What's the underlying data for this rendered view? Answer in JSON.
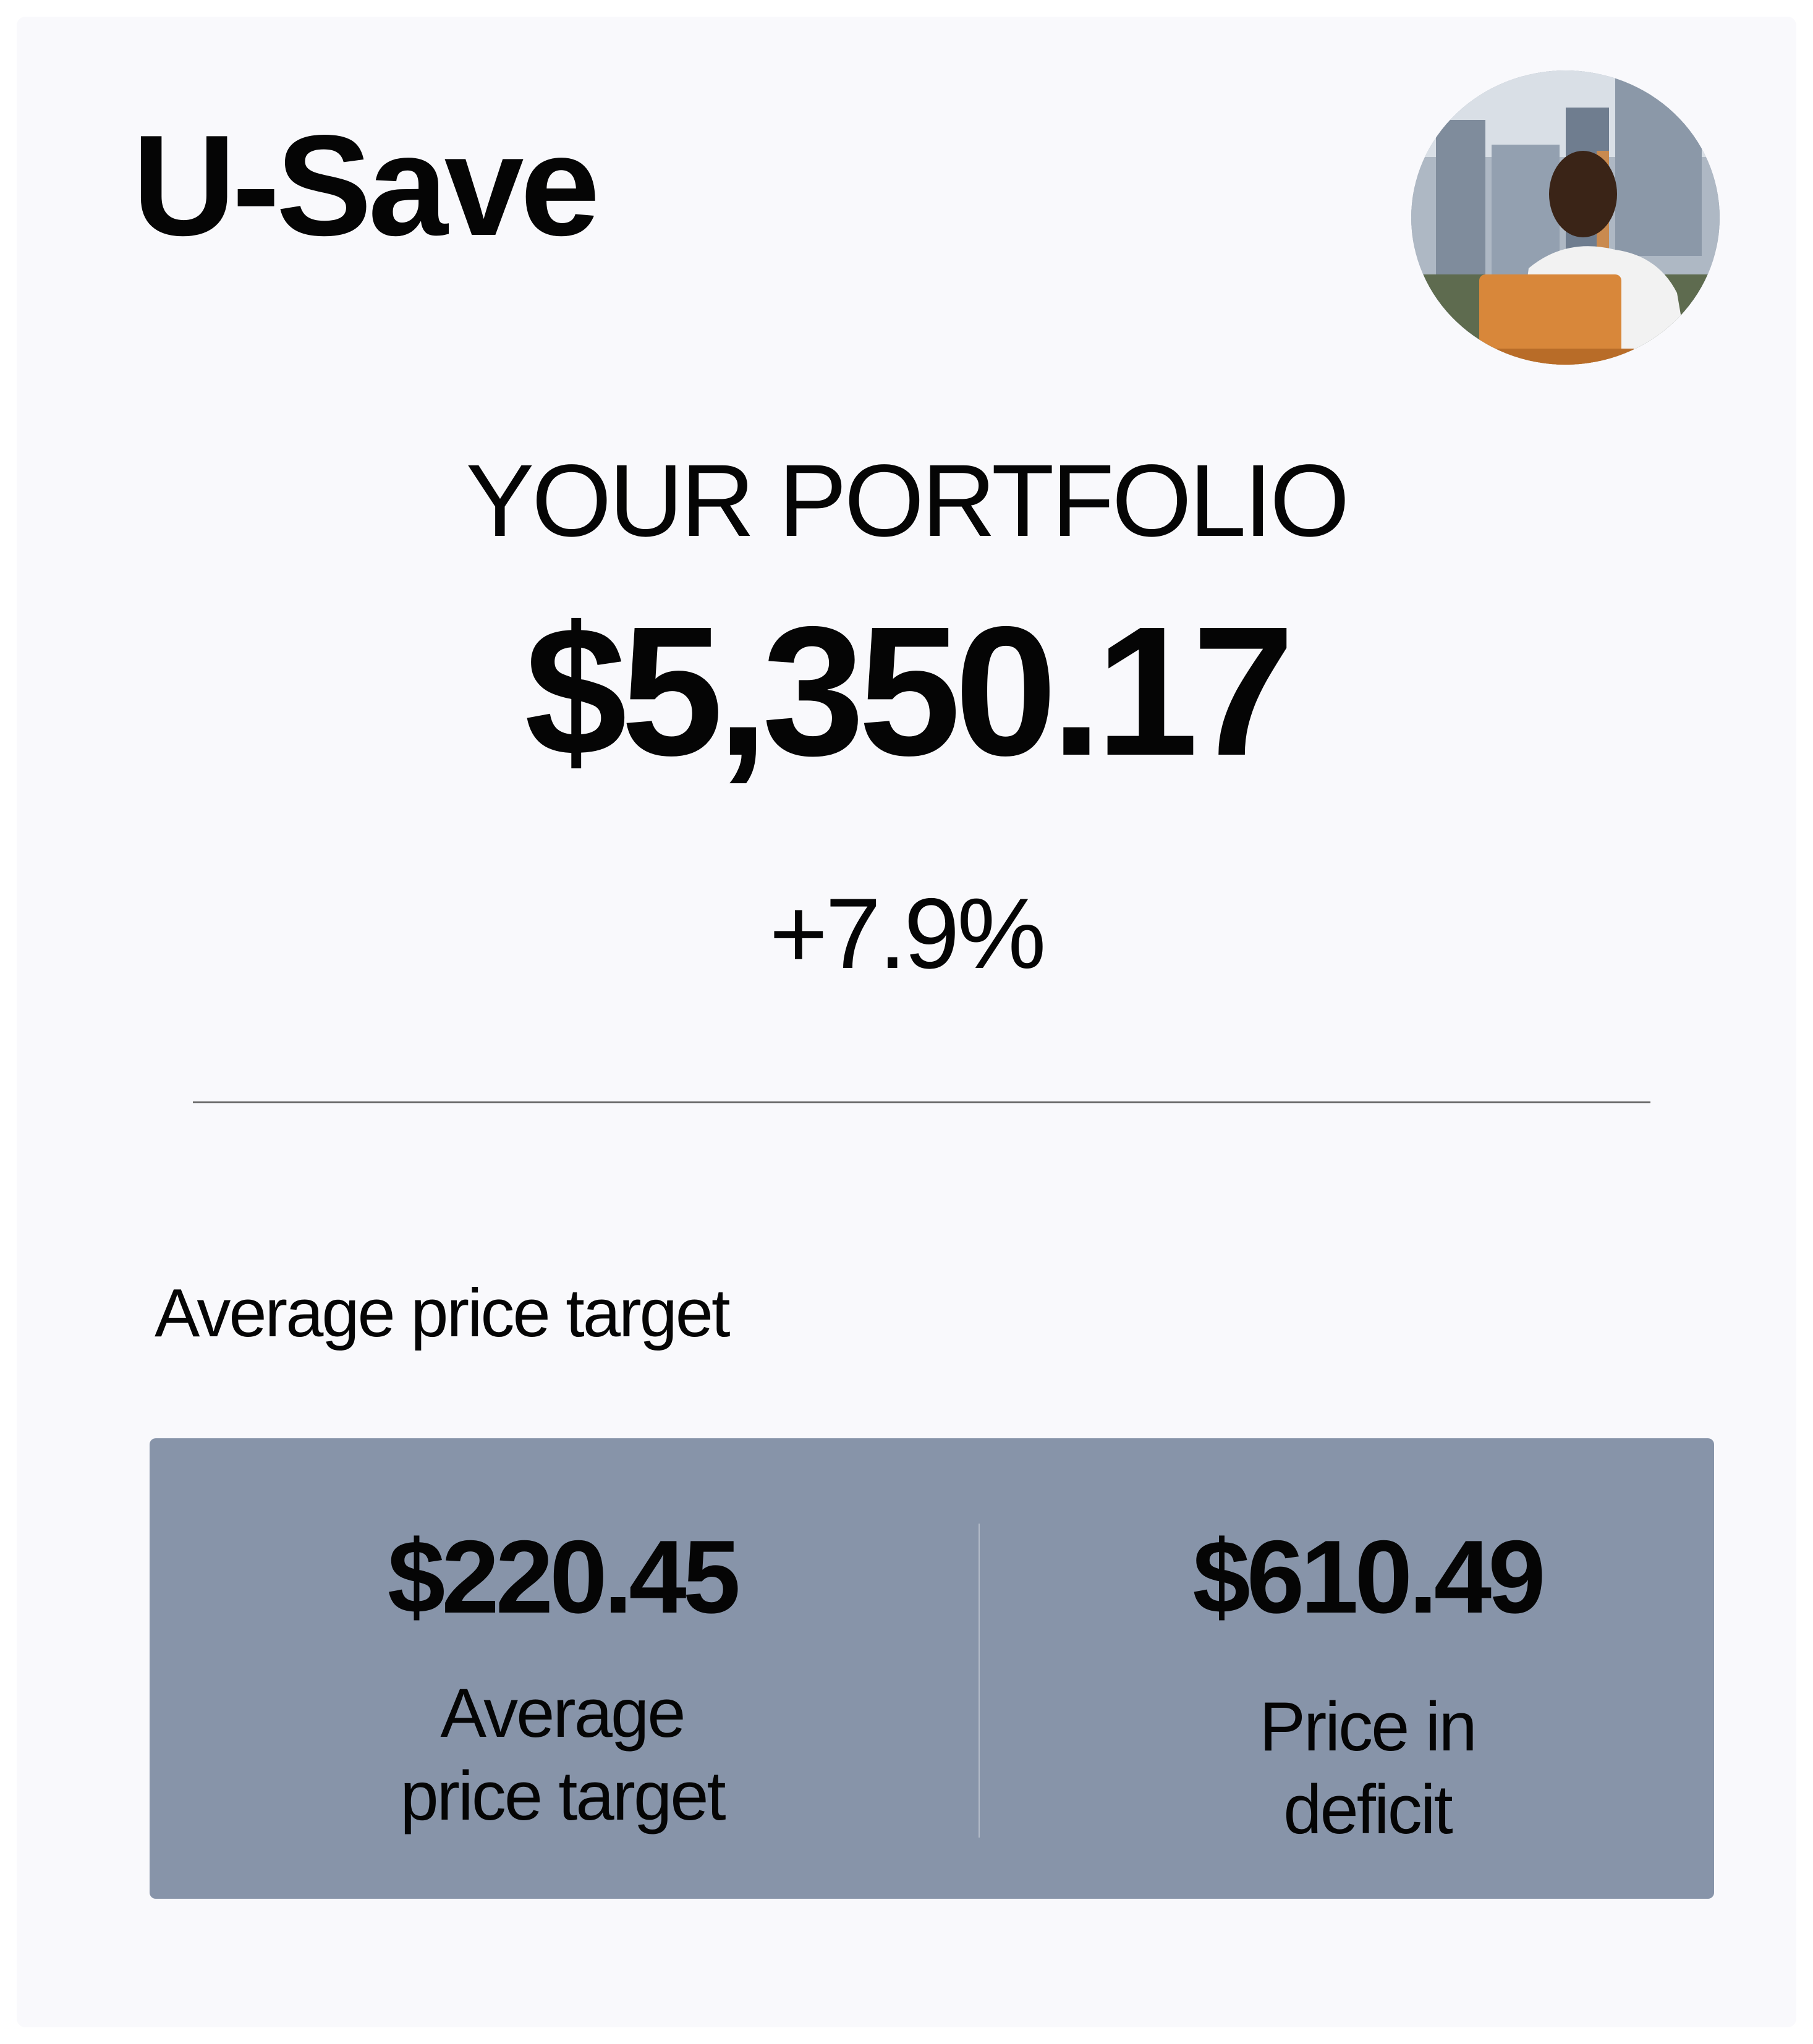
{
  "header": {
    "logo": "U-Save",
    "avatar_icon": "user-avatar-photo"
  },
  "portfolio": {
    "title": "YOUR PORTFOLIO",
    "value": "$5,350.17",
    "change": "+7.9%"
  },
  "section": {
    "heading": "Average price target"
  },
  "stats": {
    "left": {
      "value": "$220.45",
      "label_line1": "Average",
      "label_line2": "price target"
    },
    "right": {
      "value": "$610.49",
      "label_line1": "Price in",
      "label_line2": "deficit"
    }
  },
  "colors": {
    "background": "#f9f9fc",
    "text": "#050505",
    "panel": "#8794a9"
  }
}
